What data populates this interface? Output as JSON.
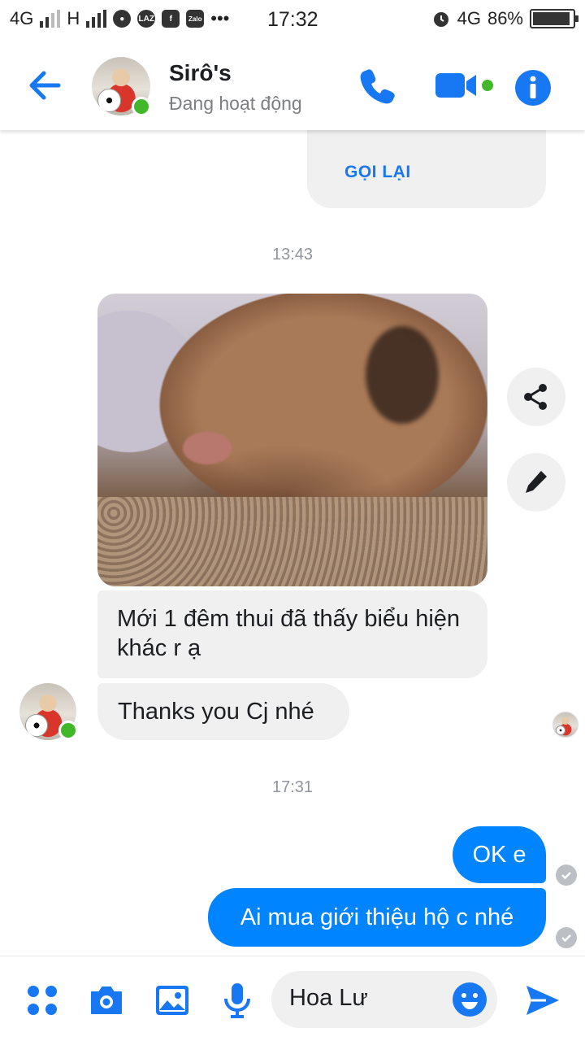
{
  "status_bar": {
    "network1": "4G",
    "network2": "H",
    "app_icon_1": "LAZ",
    "app_icon_2": "f",
    "app_icon_3": "Zalo",
    "more": "•••",
    "time": "17:32",
    "network3": "4G",
    "battery": "86%",
    "battery_level": 0.86
  },
  "header": {
    "contact_name": "Sirô's",
    "contact_status": "Đang hoạt động",
    "icons": [
      "back-arrow-icon",
      "phone-icon",
      "video-camera-icon",
      "info-icon"
    ]
  },
  "chat": {
    "call_card_action": "GỌI LẠI",
    "timestamp_1": "13:43",
    "msg_in_1": "Mới 1 đêm thui đã thấy biểu hiện khác r ạ",
    "msg_in_2": "Thanks you Cj nhé",
    "timestamp_2": "17:31",
    "msg_out_1": "OK e",
    "msg_out_2": "Ai mua giới thiệu hộ c nhé"
  },
  "composer": {
    "input_value": "Hoa Lư",
    "icons": [
      "apps-icon",
      "camera-icon",
      "image-icon",
      "microphone-icon",
      "emoji-icon",
      "send-icon"
    ]
  },
  "colors": {
    "accent": "#0084ff",
    "online": "#42b72a",
    "bubble_in": "#f0f0f0",
    "timestamp": "#90949c"
  }
}
